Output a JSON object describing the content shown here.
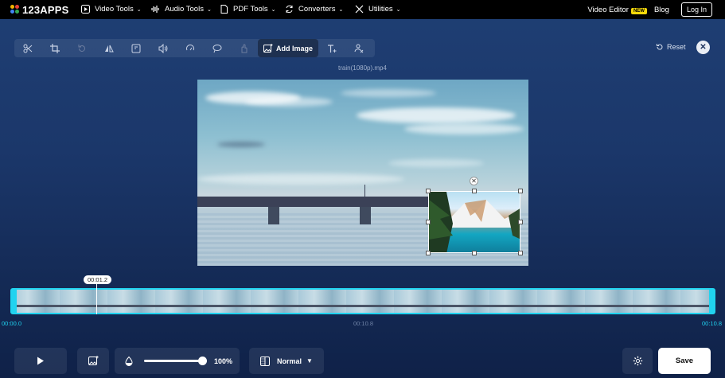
{
  "brand": {
    "name": "123APPS",
    "dot_colors": [
      "#f4b400",
      "#e94235",
      "#4285f4",
      "#34a853"
    ]
  },
  "nav": {
    "items": [
      {
        "label": "Video Tools",
        "icon": "play-square-icon"
      },
      {
        "label": "Audio Tools",
        "icon": "waveform-icon"
      },
      {
        "label": "PDF Tools",
        "icon": "document-icon"
      },
      {
        "label": "Converters",
        "icon": "convert-icon"
      },
      {
        "label": "Utilities",
        "icon": "tools-icon"
      }
    ],
    "video_editor": "Video Editor",
    "new_badge": "NEW",
    "blog": "Blog",
    "login": "Log In"
  },
  "toolbar": {
    "tools": [
      "cut-icon",
      "crop-icon",
      "rotate-icon",
      "flip-icon",
      "frame-icon",
      "volume-icon",
      "speed-icon",
      "loop-icon",
      "stabilize-icon",
      "add-image-icon",
      "add-text-icon",
      "remove-logo-icon"
    ],
    "add_image_label": "Add Image",
    "reset_label": "Reset"
  },
  "video": {
    "filename": "train(1080p).mp4"
  },
  "timeline": {
    "current_time": "00:01.2",
    "start": "00:00.0",
    "middle": "00:10.8",
    "end": "00:10.8",
    "accent": "#20d3f0"
  },
  "bottom": {
    "opacity_value": "100%",
    "opacity_fraction": 1.0,
    "blend_mode": "Normal",
    "save": "Save"
  }
}
